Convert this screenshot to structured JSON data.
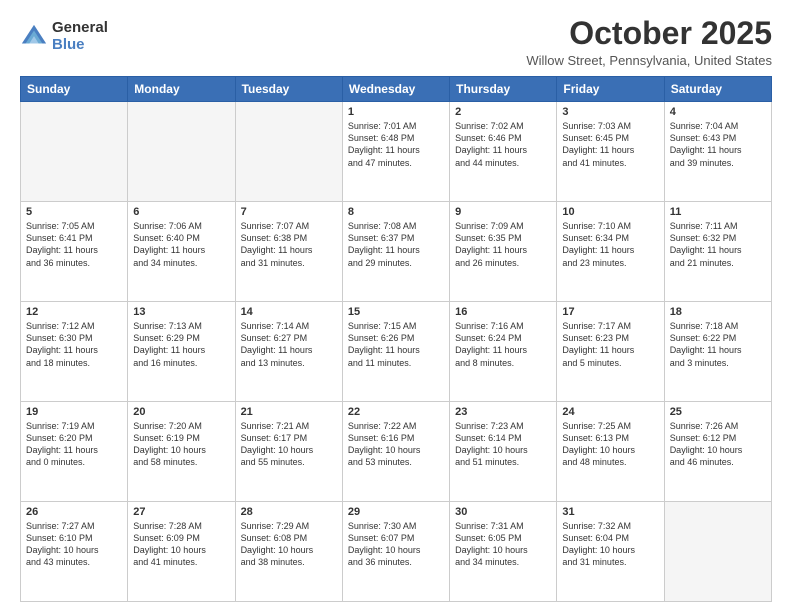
{
  "header": {
    "logo_general": "General",
    "logo_blue": "Blue",
    "month_title": "October 2025",
    "location": "Willow Street, Pennsylvania, United States"
  },
  "days_of_week": [
    "Sunday",
    "Monday",
    "Tuesday",
    "Wednesday",
    "Thursday",
    "Friday",
    "Saturday"
  ],
  "weeks": [
    [
      {
        "day": "",
        "info": ""
      },
      {
        "day": "",
        "info": ""
      },
      {
        "day": "",
        "info": ""
      },
      {
        "day": "1",
        "info": "Sunrise: 7:01 AM\nSunset: 6:48 PM\nDaylight: 11 hours\nand 47 minutes."
      },
      {
        "day": "2",
        "info": "Sunrise: 7:02 AM\nSunset: 6:46 PM\nDaylight: 11 hours\nand 44 minutes."
      },
      {
        "day": "3",
        "info": "Sunrise: 7:03 AM\nSunset: 6:45 PM\nDaylight: 11 hours\nand 41 minutes."
      },
      {
        "day": "4",
        "info": "Sunrise: 7:04 AM\nSunset: 6:43 PM\nDaylight: 11 hours\nand 39 minutes."
      }
    ],
    [
      {
        "day": "5",
        "info": "Sunrise: 7:05 AM\nSunset: 6:41 PM\nDaylight: 11 hours\nand 36 minutes."
      },
      {
        "day": "6",
        "info": "Sunrise: 7:06 AM\nSunset: 6:40 PM\nDaylight: 11 hours\nand 34 minutes."
      },
      {
        "day": "7",
        "info": "Sunrise: 7:07 AM\nSunset: 6:38 PM\nDaylight: 11 hours\nand 31 minutes."
      },
      {
        "day": "8",
        "info": "Sunrise: 7:08 AM\nSunset: 6:37 PM\nDaylight: 11 hours\nand 29 minutes."
      },
      {
        "day": "9",
        "info": "Sunrise: 7:09 AM\nSunset: 6:35 PM\nDaylight: 11 hours\nand 26 minutes."
      },
      {
        "day": "10",
        "info": "Sunrise: 7:10 AM\nSunset: 6:34 PM\nDaylight: 11 hours\nand 23 minutes."
      },
      {
        "day": "11",
        "info": "Sunrise: 7:11 AM\nSunset: 6:32 PM\nDaylight: 11 hours\nand 21 minutes."
      }
    ],
    [
      {
        "day": "12",
        "info": "Sunrise: 7:12 AM\nSunset: 6:30 PM\nDaylight: 11 hours\nand 18 minutes."
      },
      {
        "day": "13",
        "info": "Sunrise: 7:13 AM\nSunset: 6:29 PM\nDaylight: 11 hours\nand 16 minutes."
      },
      {
        "day": "14",
        "info": "Sunrise: 7:14 AM\nSunset: 6:27 PM\nDaylight: 11 hours\nand 13 minutes."
      },
      {
        "day": "15",
        "info": "Sunrise: 7:15 AM\nSunset: 6:26 PM\nDaylight: 11 hours\nand 11 minutes."
      },
      {
        "day": "16",
        "info": "Sunrise: 7:16 AM\nSunset: 6:24 PM\nDaylight: 11 hours\nand 8 minutes."
      },
      {
        "day": "17",
        "info": "Sunrise: 7:17 AM\nSunset: 6:23 PM\nDaylight: 11 hours\nand 5 minutes."
      },
      {
        "day": "18",
        "info": "Sunrise: 7:18 AM\nSunset: 6:22 PM\nDaylight: 11 hours\nand 3 minutes."
      }
    ],
    [
      {
        "day": "19",
        "info": "Sunrise: 7:19 AM\nSunset: 6:20 PM\nDaylight: 11 hours\nand 0 minutes."
      },
      {
        "day": "20",
        "info": "Sunrise: 7:20 AM\nSunset: 6:19 PM\nDaylight: 10 hours\nand 58 minutes."
      },
      {
        "day": "21",
        "info": "Sunrise: 7:21 AM\nSunset: 6:17 PM\nDaylight: 10 hours\nand 55 minutes."
      },
      {
        "day": "22",
        "info": "Sunrise: 7:22 AM\nSunset: 6:16 PM\nDaylight: 10 hours\nand 53 minutes."
      },
      {
        "day": "23",
        "info": "Sunrise: 7:23 AM\nSunset: 6:14 PM\nDaylight: 10 hours\nand 51 minutes."
      },
      {
        "day": "24",
        "info": "Sunrise: 7:25 AM\nSunset: 6:13 PM\nDaylight: 10 hours\nand 48 minutes."
      },
      {
        "day": "25",
        "info": "Sunrise: 7:26 AM\nSunset: 6:12 PM\nDaylight: 10 hours\nand 46 minutes."
      }
    ],
    [
      {
        "day": "26",
        "info": "Sunrise: 7:27 AM\nSunset: 6:10 PM\nDaylight: 10 hours\nand 43 minutes."
      },
      {
        "day": "27",
        "info": "Sunrise: 7:28 AM\nSunset: 6:09 PM\nDaylight: 10 hours\nand 41 minutes."
      },
      {
        "day": "28",
        "info": "Sunrise: 7:29 AM\nSunset: 6:08 PM\nDaylight: 10 hours\nand 38 minutes."
      },
      {
        "day": "29",
        "info": "Sunrise: 7:30 AM\nSunset: 6:07 PM\nDaylight: 10 hours\nand 36 minutes."
      },
      {
        "day": "30",
        "info": "Sunrise: 7:31 AM\nSunset: 6:05 PM\nDaylight: 10 hours\nand 34 minutes."
      },
      {
        "day": "31",
        "info": "Sunrise: 7:32 AM\nSunset: 6:04 PM\nDaylight: 10 hours\nand 31 minutes."
      },
      {
        "day": "",
        "info": ""
      }
    ]
  ]
}
